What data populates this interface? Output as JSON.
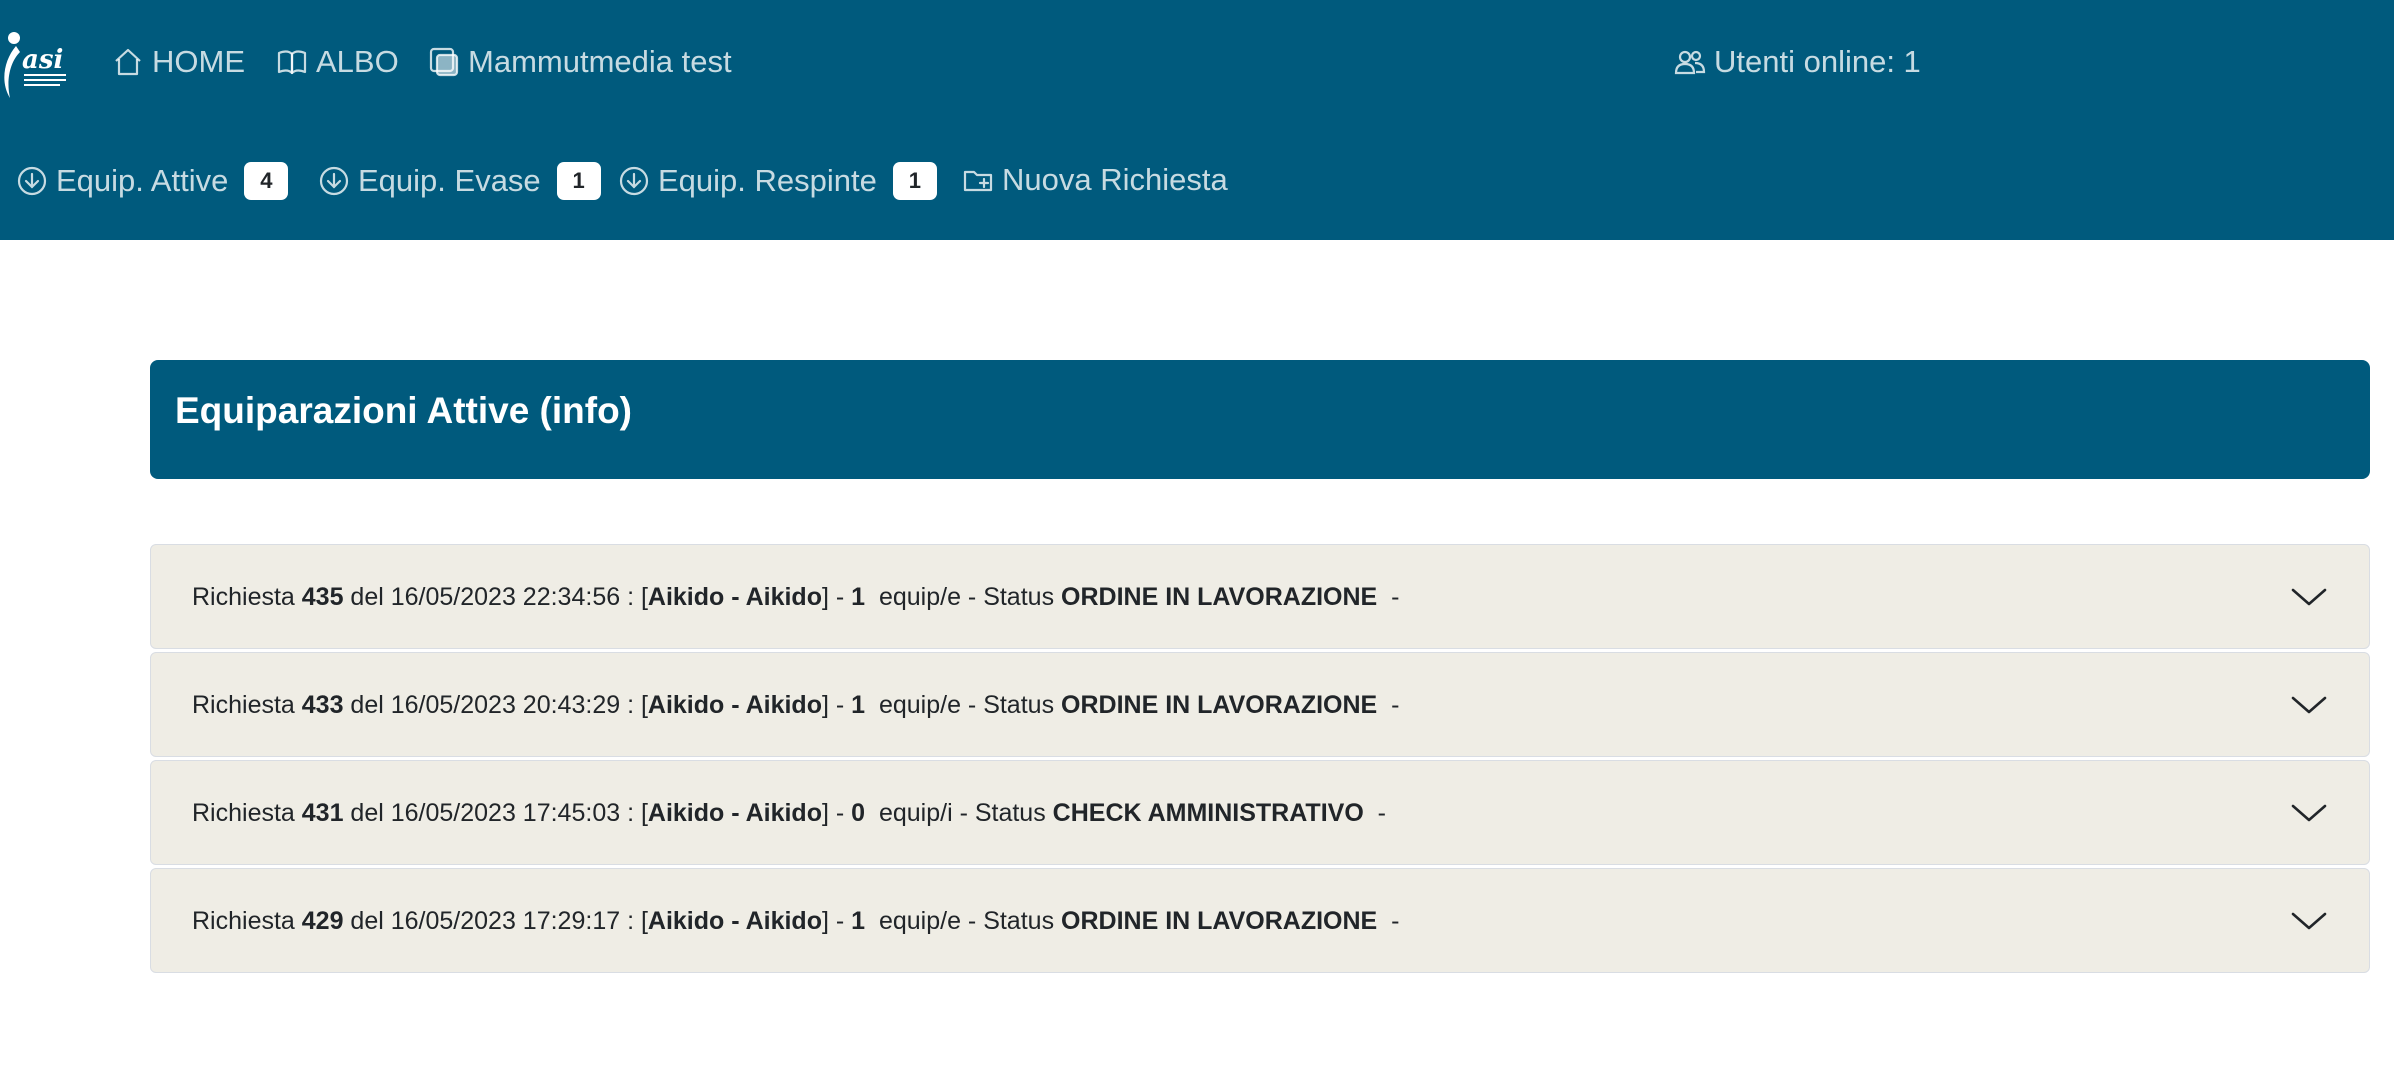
{
  "nav": {
    "logo_text": "asi",
    "home_label": "HOME",
    "albo_label": "ALBO",
    "user_label": "Mammutmedia test",
    "online_label": "Utenti online: 1"
  },
  "subnav": {
    "attive_label": "Equip. Attive",
    "attive_count": "4",
    "evase_label": "Equip. Evase",
    "evase_count": "1",
    "respinte_label": "Equip. Respinte",
    "respinte_count": "1",
    "nuova_label": "Nuova Richiesta"
  },
  "page": {
    "title": "Equiparazioni Attive (info)"
  },
  "requests": [
    {
      "prefix": "Richiesta ",
      "id": "435",
      "date": " del 16/05/2023 22:34:56 : [",
      "discipline": "Aikido - Aikido",
      "sep": "] - ",
      "count": "1",
      "unit": "  equip/e - Status ",
      "status": "ORDINE IN LAVORAZIONE",
      "tail": "  -"
    },
    {
      "prefix": "Richiesta ",
      "id": "433",
      "date": " del 16/05/2023 20:43:29 : [",
      "discipline": "Aikido - Aikido",
      "sep": "] - ",
      "count": "1",
      "unit": "  equip/e - Status ",
      "status": "ORDINE IN LAVORAZIONE",
      "tail": "  -"
    },
    {
      "prefix": "Richiesta ",
      "id": "431",
      "date": " del 16/05/2023 17:45:03 : [",
      "discipline": "Aikido - Aikido",
      "sep": "] - ",
      "count": "0",
      "unit": "  equip/i - Status ",
      "status": "CHECK AMMINISTRATIVO",
      "tail": "  -"
    },
    {
      "prefix": "Richiesta ",
      "id": "429",
      "date": " del 16/05/2023 17:29:17 : [",
      "discipline": "Aikido - Aikido",
      "sep": "] - ",
      "count": "1",
      "unit": "  equip/e - Status ",
      "status": "ORDINE IN LAVORAZIONE",
      "tail": "  -"
    }
  ],
  "colors": {
    "brand": "#005a7d",
    "accordion_bg": "#efede5"
  }
}
